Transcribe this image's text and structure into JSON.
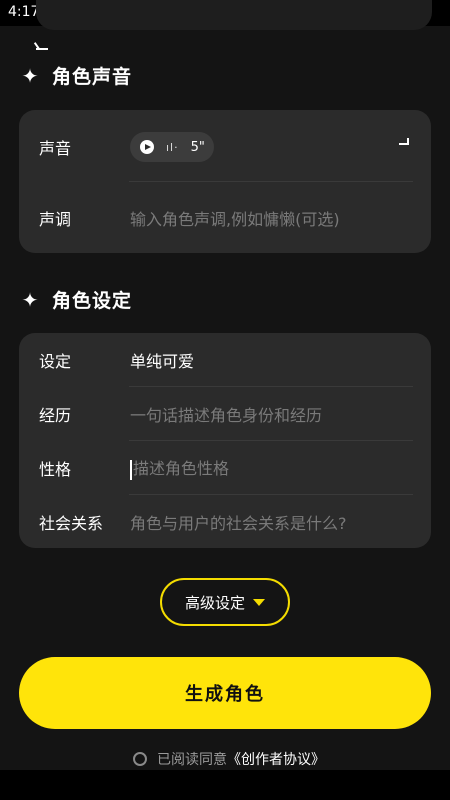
{
  "status_bar": {
    "time": "4:17"
  },
  "voice_section": {
    "title": "角色声音",
    "voice_label": "声音",
    "voice_duration": "5\"",
    "voice_wave": "ıl·",
    "tone_label": "声调",
    "tone_placeholder": "输入角色声调,例如慵懒(可选)"
  },
  "settings_section": {
    "title": "角色设定",
    "rows": [
      {
        "label": "设定",
        "value": "单纯可爱"
      },
      {
        "label": "经历",
        "placeholder": "一句话描述角色身份和经历"
      },
      {
        "label": "性格",
        "placeholder": "描述角色性格"
      },
      {
        "label": "社会关系",
        "placeholder": "角色与用户的社会关系是什么?"
      }
    ]
  },
  "advanced_button": {
    "label": "高级设定"
  },
  "generate_button": {
    "label": "生成角色"
  },
  "agreement": {
    "text": "已阅读同意",
    "link": "《创作者协议》"
  },
  "colors": {
    "accent": "#ffe40a",
    "card": "#2b2b2b",
    "background": "#141414"
  }
}
